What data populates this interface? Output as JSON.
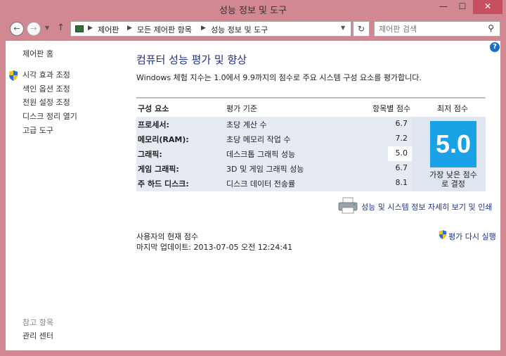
{
  "window": {
    "title": "성능 정보 및 도구",
    "minimize": "—",
    "maximize": "☐",
    "close": "✕"
  },
  "nav": {
    "back": "←",
    "forward": "→",
    "recent": "▼",
    "up": "↑",
    "breadcrumbs": [
      "제어판",
      "모든 제어판 항목",
      "성능 정보 및 도구"
    ],
    "separator": "▶",
    "address_dropdown": "▼",
    "refresh": "↻",
    "search_placeholder": "제어판 검색",
    "search_glyph": "⚲"
  },
  "help": "?",
  "sidebar": {
    "home": "제어판 홈",
    "links": [
      "시각 효과 조정",
      "색인 옵션 조정",
      "전원 설정 조정",
      "디스크 정리 열기",
      "고급 도구"
    ],
    "see_also_heading": "참고 항목",
    "see_also_items": [
      "관리 센터"
    ]
  },
  "main": {
    "title": "컴퓨터 성능 평가 및 향상",
    "subtitle": "Windows 체험 지수는 1.0에서 9.9까지의 점수로 주요 시스템 구성 요소를 평가합니다.",
    "table": {
      "headers": {
        "component": "구성 요소",
        "rated": "평가 기준",
        "subscore": "항목별 점수",
        "base": "최저 점수"
      },
      "rows": [
        {
          "name": "프로세서:",
          "desc": "초당 계산 수",
          "score": "6.7"
        },
        {
          "name": "메모리(RAM):",
          "desc": "초당 메모리 작업 수",
          "score": "7.2"
        },
        {
          "name": "그래픽:",
          "desc": "데스크톱 그래픽 성능",
          "score": "5.0"
        },
        {
          "name": "게임 그래픽:",
          "desc": "3D 및 게임 그래픽 성능",
          "score": "6.7"
        },
        {
          "name": "주 하드 디스크:",
          "desc": "디스크 데이터 전송률",
          "score": "8.1"
        }
      ],
      "base_score": "5.0",
      "base_note": "가장 낮은 점수\n로 결정",
      "lowest_row_index": 2
    },
    "detail_link": "성능 및 시스템 정보 자세히 보기 및 인쇄",
    "user_score_label": "사용자의 현재 점수",
    "last_update": "마지막 업데이트: 2013-07-05 오전 12:24:41",
    "rerun": "평가 다시 실행"
  },
  "colors": {
    "accent": "#1e3287",
    "tile": "#1aa2e6",
    "frame": "#d28892"
  }
}
